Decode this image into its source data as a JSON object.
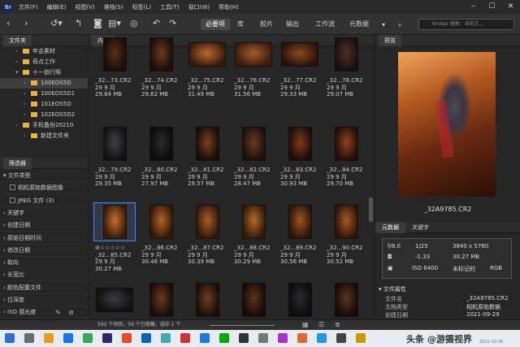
{
  "app": {
    "logo": "Br"
  },
  "menu": [
    "文件(F)",
    "编辑(E)",
    "视图(V)",
    "堆栈(S)",
    "标签(L)",
    "工具(T)",
    "窗口(W)",
    "帮助(H)"
  ],
  "window_buttons": [
    "‒",
    "☐",
    "✕"
  ],
  "toolbar": {
    "workspaces": [
      "必要项",
      "库",
      "胶片",
      "输出",
      "工作流",
      "元数据"
    ],
    "search_placeholder": "Bridge 搜索：当前文..."
  },
  "left": {
    "folders_tab": "文件夹",
    "tree": [
      {
        "label": "年会素材",
        "indent": 28,
        "folder": false
      },
      {
        "label": "奇点工作",
        "indent": 28,
        "folder": true
      },
      {
        "label": "十一旅行照",
        "indent": 28,
        "folder": true,
        "open": true
      },
      {
        "label": "100EOS5D",
        "indent": 38,
        "folder": true,
        "selected": true
      },
      {
        "label": "100EOS5D1",
        "indent": 38,
        "folder": true
      },
      {
        "label": "101EOS5D",
        "indent": 38,
        "folder": true
      },
      {
        "label": "102EOS5D2",
        "indent": 38,
        "folder": true
      },
      {
        "label": "手机备份20210",
        "indent": 28,
        "folder": true
      },
      {
        "label": "新建文件夹",
        "indent": 38,
        "folder": true
      }
    ],
    "filter_tab": "筛选器",
    "filters": [
      {
        "label": "文件类型",
        "expanded": true
      },
      {
        "label": "相机原始数据图像",
        "check": true
      },
      {
        "label": "JPEG 文件 (3)",
        "check": true
      },
      {
        "label": "关键字"
      },
      {
        "label": "创建日期"
      },
      {
        "label": "原始日期时间"
      },
      {
        "label": "修改日期"
      },
      {
        "label": "取向"
      },
      {
        "label": "长宽比"
      },
      {
        "label": "颜色配置文件"
      },
      {
        "label": "位深度"
      },
      {
        "label": "ISO 感光度"
      }
    ]
  },
  "content": {
    "tab": "内容",
    "rows": [
      [
        {
          "name": "_32...73.CR2",
          "date": "29 9 月",
          "size": "29.84 MB",
          "c1": "#5a3018",
          "c2": "#1a0c06",
          "land": false
        },
        {
          "name": "_32...74.CR2",
          "date": "29 9 月",
          "size": "29.62 MB",
          "c1": "#6a3a1c",
          "c2": "#1c0d08",
          "land": false
        },
        {
          "name": "_32...75.CR2",
          "date": "29 9 月",
          "size": "31.49 MB",
          "c1": "#b86a30",
          "c2": "#3a1a0a",
          "land": true
        },
        {
          "name": "_32...76.CR2",
          "date": "29 9 月",
          "size": "31.56 MB",
          "c1": "#a45c2a",
          "c2": "#3c1c0c",
          "land": true
        },
        {
          "name": "_32...77.CR2",
          "date": "29 9 月",
          "size": "29.33 MB",
          "c1": "#8a4a20",
          "c2": "#2a1208",
          "land": true
        },
        {
          "name": "_32...78.CR2",
          "date": "29 9 月",
          "size": "29.07 MB",
          "c1": "#503020",
          "c2": "#181010",
          "land": false
        }
      ],
      [
        {
          "name": "_32...79.CR2",
          "date": "29 9 月",
          "size": "29.35 MB",
          "c1": "#404048",
          "c2": "#121214",
          "land": false
        },
        {
          "name": "_32...80.CR2",
          "date": "29 9 月",
          "size": "27.97 MB",
          "c1": "#2a2a30",
          "c2": "#0c0c0e",
          "land": false
        },
        {
          "name": "_32...81.CR2",
          "date": "29 9 月",
          "size": "29.57 MB",
          "c1": "#7a4020",
          "c2": "#1a0c06",
          "land": false
        },
        {
          "name": "_32...82.CR2",
          "date": "29 9 月",
          "size": "28.47 MB",
          "c1": "#6a3a20",
          "c2": "#1e100a",
          "land": false
        },
        {
          "name": "_32...83.CR2",
          "date": "29 9 月",
          "size": "30.93 MB",
          "c1": "#7c3a1c",
          "c2": "#200c06",
          "land": false
        },
        {
          "name": "_32...84.CR2",
          "date": "29 9 月",
          "size": "29.70 MB",
          "c1": "#8a4220",
          "c2": "#240e06",
          "land": false
        }
      ],
      [
        {
          "name": "_32...85.CR2",
          "date": "29 9 月",
          "size": "30.27 MB",
          "c1": "#c07030",
          "c2": "#3a1a08",
          "land": false,
          "selected": true,
          "stars": "⊘☆☆☆☆☆"
        },
        {
          "name": "_32...86.CR2",
          "date": "29 9 月",
          "size": "30.46 MB",
          "c1": "#b06428",
          "c2": "#361806",
          "land": false
        },
        {
          "name": "_32...87.CR2",
          "date": "29 9 月",
          "size": "30.39 MB",
          "c1": "#a85e28",
          "c2": "#321608",
          "land": false
        },
        {
          "name": "_32...88.CR2",
          "date": "29 9 月",
          "size": "30.29 MB",
          "c1": "#b46a2c",
          "c2": "#341808",
          "land": false
        },
        {
          "name": "_32...89.CR2",
          "date": "29 9 月",
          "size": "30.56 MB",
          "c1": "#9c5424",
          "c2": "#2e1406",
          "land": false
        },
        {
          "name": "_32...90.CR2",
          "date": "29 9 月",
          "size": "30.52 MB",
          "c1": "#a45a26",
          "c2": "#301408",
          "land": false
        }
      ],
      [
        {
          "name": "",
          "date": "",
          "size": "",
          "c1": "#3a3a44",
          "c2": "#101012",
          "land": true
        },
        {
          "name": "",
          "date": "",
          "size": "",
          "c1": "#6a3a20",
          "c2": "#1a0c06",
          "land": false
        },
        {
          "name": "",
          "date": "",
          "size": "",
          "c1": "#6e3e22",
          "c2": "#1c0e06",
          "land": false
        },
        {
          "name": "",
          "date": "",
          "size": "",
          "c1": "#5e321c",
          "c2": "#180a06",
          "land": false
        },
        {
          "name": "",
          "date": "",
          "size": "",
          "c1": "#2a2a30",
          "c2": "#0c0c0e",
          "land": false
        },
        {
          "name": "",
          "date": "",
          "size": "",
          "c1": "#5a3420",
          "c2": "#160a06",
          "land": false
        }
      ]
    ]
  },
  "preview": {
    "tab": "预览",
    "filename": "_32A9785.CR2",
    "meta_tabs": [
      "元数据",
      "关键字"
    ],
    "camera": {
      "aperture": "f/8.0",
      "shutter": "1/25",
      "dims": "3840 x 5760",
      "ev": "-1.33",
      "size": "30.27 MB",
      "iso": "ISO 6400",
      "tag": "未标记的",
      "color": "RGB"
    },
    "file_props_title": "文件属性",
    "props": [
      {
        "k": "文件名",
        "v": "_32A9785.CR2"
      },
      {
        "k": "文档类型",
        "v": "相机原始数据"
      },
      {
        "k": "创建日期",
        "v": "2021-09-29"
      }
    ]
  },
  "status": {
    "text": "592 个项目，56 个已隐藏，选中 1 个"
  },
  "taskbar": {
    "icons": [
      "#2f6fd6",
      "#6b6b6b",
      "#e89b1c",
      "#1a73e8",
      "#35a853",
      "#2a2a6a",
      "#e84a2a",
      "#0a64b4",
      "#4aa",
      "#c33",
      "#27d",
      "#0a0",
      "#333",
      "#777",
      "#a3c",
      "#d63",
      "#29d",
      "#444",
      "#c90"
    ],
    "watermark": "头条 @游摄视界",
    "date": "2021-10-28"
  },
  "colors": {
    "accent": "#3d8bff",
    "folder": "#e7b33a"
  }
}
